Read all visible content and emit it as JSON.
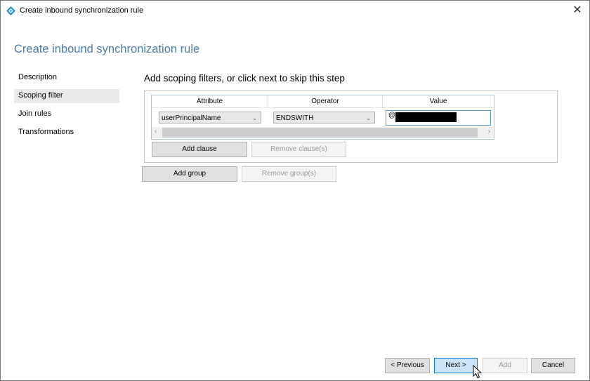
{
  "window": {
    "title": "Create inbound synchronization rule",
    "close_label": "✕"
  },
  "page": {
    "title": "Create inbound synchronization rule"
  },
  "nav": {
    "items": [
      {
        "label": "Description",
        "active": false
      },
      {
        "label": "Scoping filter",
        "active": true
      },
      {
        "label": "Join rules",
        "active": false
      },
      {
        "label": "Transformations",
        "active": false
      }
    ]
  },
  "scoping": {
    "heading": "Add scoping filters, or click next to skip this step",
    "columns": [
      "Attribute",
      "Operator",
      "Value"
    ],
    "rows": [
      {
        "attribute": "userPrincipalName",
        "operator": "ENDSWITH",
        "value_prefix": "@",
        "value_redacted": true
      }
    ],
    "add_clause": "Add clause",
    "remove_clause": "Remove clause(s)",
    "add_group": "Add group",
    "remove_group": "Remove group(s)"
  },
  "footer": {
    "previous": "< Previous",
    "next": "Next >",
    "add": "Add",
    "cancel": "Cancel"
  },
  "colors": {
    "accent": "#4a7aa8",
    "primary_button_bg": "#cce4f7",
    "primary_button_border": "#0078d7"
  }
}
